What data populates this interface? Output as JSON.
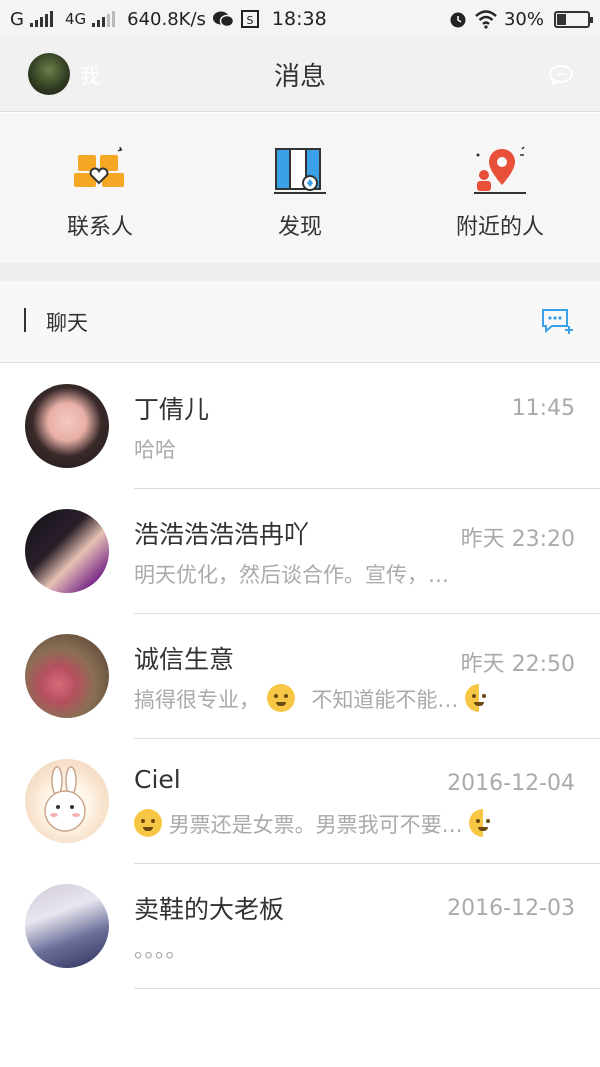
{
  "status_bar": {
    "carrier": "G",
    "network": "4G",
    "speed": "640.8K/s",
    "time": "18:38",
    "battery": "30%",
    "battery_level": 0.3
  },
  "header": {
    "me_label": "我",
    "title": "消息"
  },
  "quick_actions": [
    {
      "label": "联系人",
      "icon": "contacts-icon"
    },
    {
      "label": "发现",
      "icon": "discover-icon"
    },
    {
      "label": "附近的人",
      "icon": "nearby-icon"
    }
  ],
  "section": {
    "label": "聊天"
  },
  "chats": [
    {
      "name": "丁倩儿",
      "time": "11:45",
      "preview": "哈哈"
    },
    {
      "name": "浩浩浩浩浩冉吖",
      "time": "昨天 23:20",
      "preview": "明天优化，然后谈合作。宣传，…"
    },
    {
      "name": "诚信生意",
      "time": "昨天 22:50",
      "preview_a": "搞得很专业，",
      "preview_b": "不知道能不能…"
    },
    {
      "name": "Ciel",
      "time": "2016-12-04",
      "preview": "男票还是女票。男票我可不要…"
    },
    {
      "name": "卖鞋的大老板",
      "time": "2016-12-03",
      "preview": "。。。。"
    }
  ],
  "colors": {
    "accent_blue": "#3aa0e8",
    "accent_orange": "#f5a623",
    "accent_red": "#e8503a"
  }
}
